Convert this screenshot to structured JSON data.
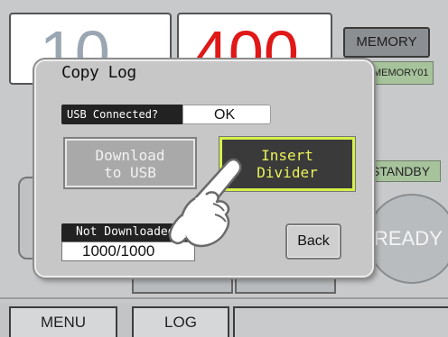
{
  "background": {
    "readout_left": "10",
    "readout_right": "400",
    "memory_button": "MEMORY",
    "memory_name": "MEMORY01",
    "status": "STANDBY",
    "ready": "READY",
    "tabs": [
      "MENU",
      "LOG"
    ]
  },
  "dialog": {
    "title": "Copy Log",
    "usb_label": "USB Connected?",
    "usb_value": "OK",
    "download_button": {
      "line1": "Download",
      "line2": "to USB"
    },
    "insert_button": {
      "line1": "Insert",
      "line2": "Divider"
    },
    "not_downloaded_label": "Not Downloaded",
    "not_downloaded_value": "1000/1000",
    "back_button": "Back"
  },
  "colors": {
    "accent_red": "#e01818",
    "insert_highlight": "#d5f04a",
    "status_green": "#a7c39c"
  },
  "icons": {
    "pointer": "pointing-hand-icon"
  }
}
